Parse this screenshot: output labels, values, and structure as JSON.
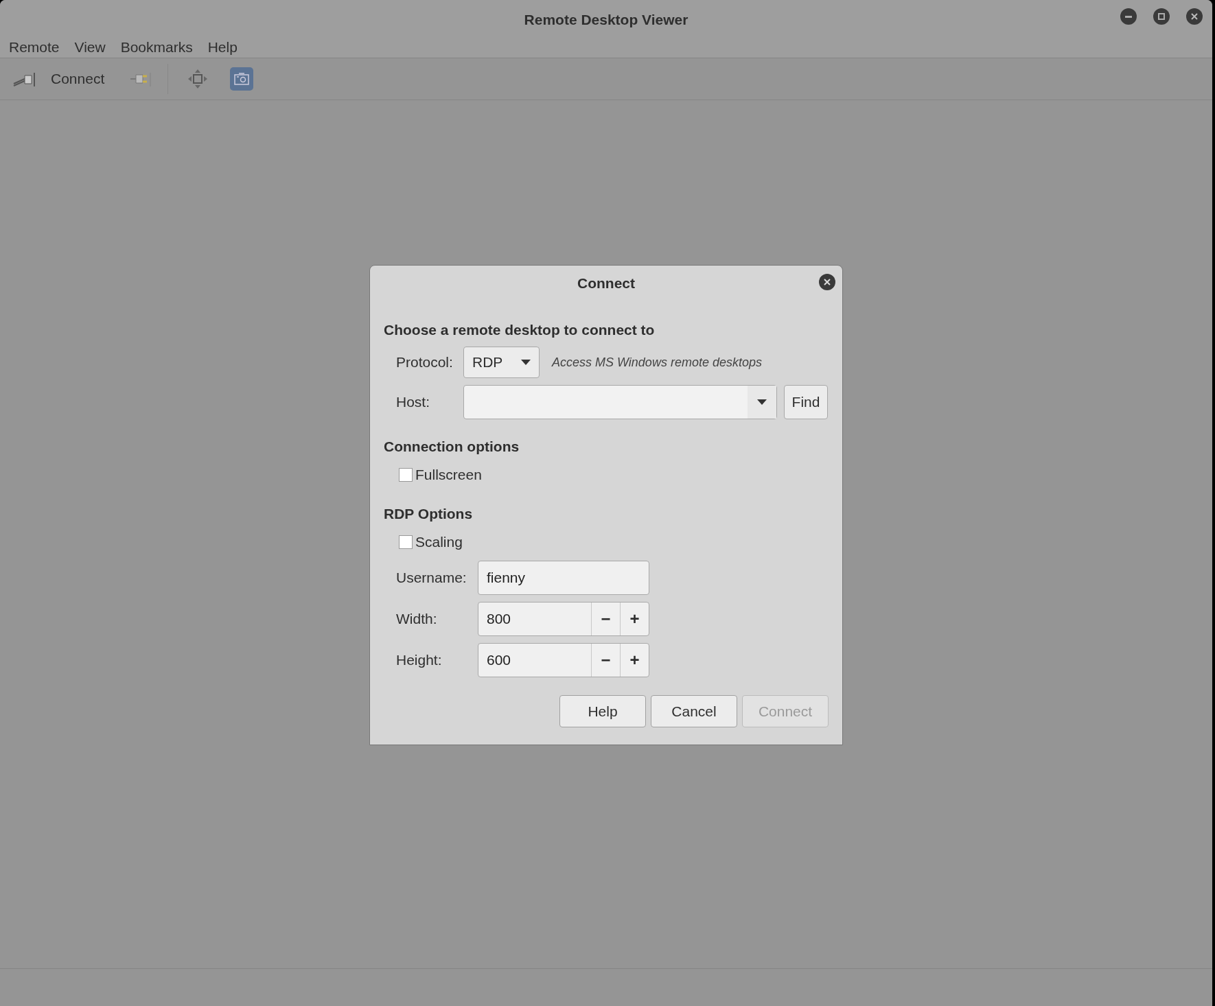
{
  "window": {
    "title": "Remote Desktop Viewer"
  },
  "menu": [
    "Remote",
    "View",
    "Bookmarks",
    "Help"
  ],
  "toolbar": {
    "connect_label": "Connect"
  },
  "dialog": {
    "title": "Connect",
    "heading": "Choose a remote desktop to connect to",
    "protocol": {
      "label": "Protocol:",
      "value": "RDP",
      "hint": "Access MS Windows remote desktops"
    },
    "host": {
      "label": "Host:",
      "button": "Find"
    },
    "connection_options": {
      "heading": "Connection options",
      "checkboxes": [
        {
          "label": "Fullscreen",
          "checked": false
        }
      ]
    },
    "rdp_options": {
      "heading": "RDP Options",
      "checkboxes": [
        {
          "label": "Scaling",
          "checked": false
        }
      ],
      "fields": [
        {
          "kind": "text",
          "label": "Username:",
          "value": "fienny"
        },
        {
          "kind": "spin",
          "label": "Width:",
          "value": "800",
          "minus": "−",
          "plus": "+"
        },
        {
          "kind": "spin",
          "label": "Height:",
          "value": "600",
          "minus": "−",
          "plus": "+"
        }
      ]
    },
    "buttons": [
      {
        "label": "Help",
        "disabled": false
      },
      {
        "label": "Cancel",
        "disabled": false
      },
      {
        "label": "Connect",
        "disabled": true
      }
    ]
  }
}
